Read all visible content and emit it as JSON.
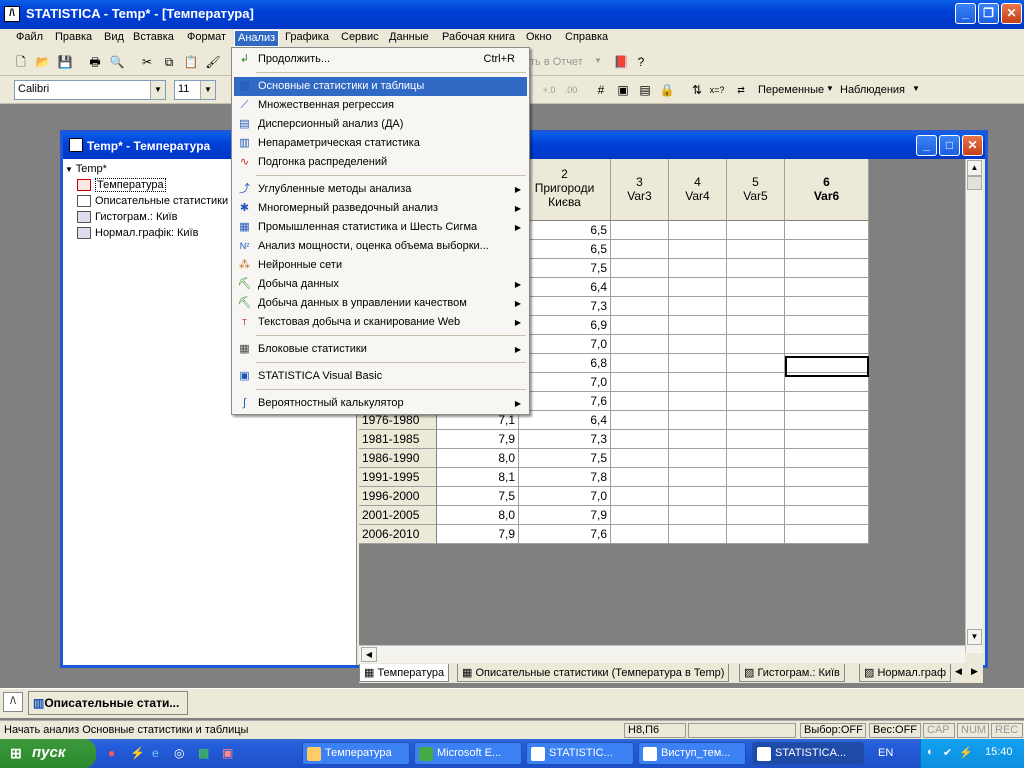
{
  "app": {
    "title": "STATISTICA - Temp* - [Температура]"
  },
  "menubar": [
    "Файл",
    "Правка",
    "Вид",
    "Вставка",
    "Формат",
    "Анализ",
    "Графика",
    "Сервис",
    "Данные",
    "Рабочая книга",
    "Окно",
    "Справка"
  ],
  "toolbar": {
    "font": "Calibri",
    "size": "11",
    "report_label": "ть в Отчет",
    "variables": "Переменные",
    "observations": "Наблюдения",
    "glyph_xeq": "x=?"
  },
  "doc": {
    "title": "Temp* - Температура",
    "tree": {
      "root": "Temp*",
      "items": [
        "Температура",
        "Описательные статистики",
        "Гистограм.: Київ",
        "Нормал.графік: Київ"
      ]
    }
  },
  "grid": {
    "columns": [
      {
        "num": "2",
        "name": "Пригороди Києва"
      },
      {
        "num": "3",
        "name": "Var3"
      },
      {
        "num": "4",
        "name": "Var4"
      },
      {
        "num": "5",
        "name": "Var5"
      },
      {
        "num": "6",
        "name": "Var6"
      }
    ],
    "rows": [
      {
        "label": "",
        "c1": "",
        "c2": "6,5"
      },
      {
        "label": "",
        "c1": "",
        "c2": "6,5"
      },
      {
        "label": "",
        "c1": "",
        "c2": "7,5"
      },
      {
        "label": "",
        "c1": "",
        "c2": "6,4"
      },
      {
        "label": "",
        "c1": "",
        "c2": "7,3"
      },
      {
        "label": "",
        "c1": "",
        "c2": "6,9"
      },
      {
        "label": "",
        "c1": "",
        "c2": "7,0"
      },
      {
        "label": "",
        "c1": "",
        "c2": "6,8"
      },
      {
        "label": "",
        "c1": "",
        "c2": "7,0"
      },
      {
        "label": "",
        "c1": "",
        "c2": "7,6"
      },
      {
        "label": "1976-1980",
        "c1": "7,1",
        "c2": "6,4"
      },
      {
        "label": "1981-1985",
        "c1": "7,9",
        "c2": "7,3"
      },
      {
        "label": "1986-1990",
        "c1": "8,0",
        "c2": "7,5"
      },
      {
        "label": "1991-1995",
        "c1": "8,1",
        "c2": "7,8"
      },
      {
        "label": "1996-2000",
        "c1": "7,5",
        "c2": "7,0"
      },
      {
        "label": "2001-2005",
        "c1": "8,0",
        "c2": "7,9"
      },
      {
        "label": "2006-2010",
        "c1": "7,9",
        "c2": "7,6"
      }
    ],
    "tabs": [
      "Температура",
      "Описательные статистики (Температура в Temp)",
      "Гистограм.: Київ",
      "Нормал.граф"
    ]
  },
  "menu": {
    "continue": "Продолжить...",
    "continue_sc": "Ctrl+R",
    "items": [
      "Основные статистики и таблицы",
      "Множественная регрессия",
      "Дисперсионный анализ (ДА)",
      "Непараметрическая статистика",
      "Подгонка распределений",
      "Углубленные методы анализа",
      "Многомерный разведочный анализ",
      "Промышленная статистика и Шесть Сигма",
      "Анализ мощности, оценка объема выборки...",
      "Нейронные сети",
      "Добыча данных",
      "Добыча данных в управлении качеством",
      "Текстовая добыча и сканирование Web",
      "Блоковые статистики",
      "STATISTICA Visual Basic",
      "Вероятностный калькулятор"
    ]
  },
  "taskwin": {
    "label": "Описательные стати..."
  },
  "status": {
    "text": "Начать анализ Основные статистики и таблицы",
    "cell": "H8,П6",
    "sel": "Выбор:OFF",
    "weight": "Вес:OFF",
    "cap": "CAP",
    "num": "NUM",
    "rec": "REC"
  },
  "taskbar": {
    "start": "пуск",
    "tasks": [
      "Температура",
      "Microsoft E...",
      "STATISTIC...",
      "Виступ_тем...",
      "STATISTICA..."
    ],
    "lang": "EN",
    "time": "15:40"
  }
}
